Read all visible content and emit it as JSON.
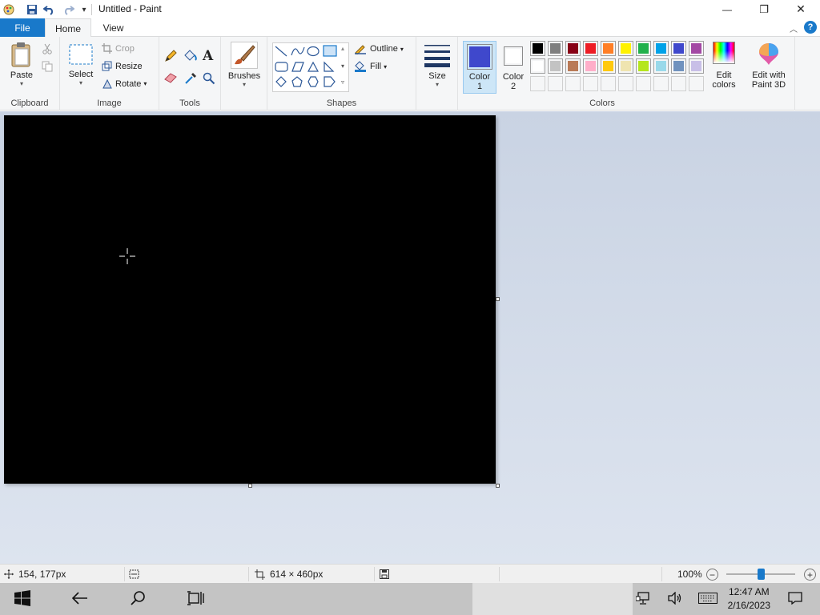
{
  "window": {
    "title": "Untitled - Paint",
    "minimize_glyph": "—",
    "maximize_glyph": "❐",
    "close_glyph": "✕"
  },
  "tabs": [
    {
      "label": "File"
    },
    {
      "label": "Home"
    },
    {
      "label": "View"
    }
  ],
  "ribbon": {
    "clipboard": {
      "group_label": "Clipboard",
      "paste_label": "Paste"
    },
    "image": {
      "group_label": "Image",
      "select_label": "Select",
      "crop_label": "Crop",
      "resize_label": "Resize",
      "rotate_label": "Rotate"
    },
    "tools": {
      "group_label": "Tools"
    },
    "brushes": {
      "label": "Brushes"
    },
    "shapes": {
      "group_label": "Shapes",
      "outline_label": "Outline",
      "fill_label": "Fill"
    },
    "size": {
      "label": "Size"
    },
    "colors": {
      "group_label": "Colors",
      "color1_label": "Color",
      "color1_num": "1",
      "color2_label": "Color",
      "color2_num": "2",
      "color1_value": "#3f48cc",
      "color2_value": "#ffffff",
      "edit_colors_label1": "Edit",
      "edit_colors_label2": "colors",
      "paint3d_label1": "Edit with",
      "paint3d_label2": "Paint 3D",
      "palette_row1": [
        "#000000",
        "#7f7f7f",
        "#880015",
        "#ed1c24",
        "#ff7f27",
        "#fff200",
        "#22b14c",
        "#00a2e8",
        "#3f48cc",
        "#a349a4"
      ],
      "palette_row2": [
        "#ffffff",
        "#c3c3c3",
        "#b97a57",
        "#ffaec9",
        "#ffc90e",
        "#efe4b0",
        "#b5e61d",
        "#99d9ea",
        "#7092be",
        "#c8bfe7"
      ]
    }
  },
  "canvas": {
    "background": "#000000"
  },
  "statusbar": {
    "cursor_pos": "154, 177px",
    "canvas_size": "614 × 460px",
    "zoom": "100%",
    "zoom_level": 1.0
  },
  "taskbar": {
    "time": "12:47 AM",
    "date": "2/16/2023"
  }
}
